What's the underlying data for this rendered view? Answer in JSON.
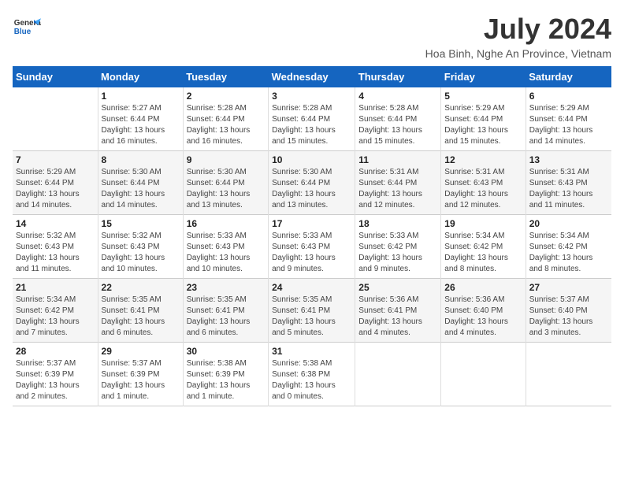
{
  "header": {
    "logo_general": "General",
    "logo_blue": "Blue",
    "month_year": "July 2024",
    "location": "Hoa Binh, Nghe An Province, Vietnam"
  },
  "days_of_week": [
    "Sunday",
    "Monday",
    "Tuesday",
    "Wednesday",
    "Thursday",
    "Friday",
    "Saturday"
  ],
  "weeks": [
    [
      {
        "day": "",
        "info": ""
      },
      {
        "day": "1",
        "info": "Sunrise: 5:27 AM\nSunset: 6:44 PM\nDaylight: 13 hours\nand 16 minutes."
      },
      {
        "day": "2",
        "info": "Sunrise: 5:28 AM\nSunset: 6:44 PM\nDaylight: 13 hours\nand 16 minutes."
      },
      {
        "day": "3",
        "info": "Sunrise: 5:28 AM\nSunset: 6:44 PM\nDaylight: 13 hours\nand 15 minutes."
      },
      {
        "day": "4",
        "info": "Sunrise: 5:28 AM\nSunset: 6:44 PM\nDaylight: 13 hours\nand 15 minutes."
      },
      {
        "day": "5",
        "info": "Sunrise: 5:29 AM\nSunset: 6:44 PM\nDaylight: 13 hours\nand 15 minutes."
      },
      {
        "day": "6",
        "info": "Sunrise: 5:29 AM\nSunset: 6:44 PM\nDaylight: 13 hours\nand 14 minutes."
      }
    ],
    [
      {
        "day": "7",
        "info": "Sunrise: 5:29 AM\nSunset: 6:44 PM\nDaylight: 13 hours\nand 14 minutes."
      },
      {
        "day": "8",
        "info": "Sunrise: 5:30 AM\nSunset: 6:44 PM\nDaylight: 13 hours\nand 14 minutes."
      },
      {
        "day": "9",
        "info": "Sunrise: 5:30 AM\nSunset: 6:44 PM\nDaylight: 13 hours\nand 13 minutes."
      },
      {
        "day": "10",
        "info": "Sunrise: 5:30 AM\nSunset: 6:44 PM\nDaylight: 13 hours\nand 13 minutes."
      },
      {
        "day": "11",
        "info": "Sunrise: 5:31 AM\nSunset: 6:44 PM\nDaylight: 13 hours\nand 12 minutes."
      },
      {
        "day": "12",
        "info": "Sunrise: 5:31 AM\nSunset: 6:43 PM\nDaylight: 13 hours\nand 12 minutes."
      },
      {
        "day": "13",
        "info": "Sunrise: 5:31 AM\nSunset: 6:43 PM\nDaylight: 13 hours\nand 11 minutes."
      }
    ],
    [
      {
        "day": "14",
        "info": "Sunrise: 5:32 AM\nSunset: 6:43 PM\nDaylight: 13 hours\nand 11 minutes."
      },
      {
        "day": "15",
        "info": "Sunrise: 5:32 AM\nSunset: 6:43 PM\nDaylight: 13 hours\nand 10 minutes."
      },
      {
        "day": "16",
        "info": "Sunrise: 5:33 AM\nSunset: 6:43 PM\nDaylight: 13 hours\nand 10 minutes."
      },
      {
        "day": "17",
        "info": "Sunrise: 5:33 AM\nSunset: 6:43 PM\nDaylight: 13 hours\nand 9 minutes."
      },
      {
        "day": "18",
        "info": "Sunrise: 5:33 AM\nSunset: 6:42 PM\nDaylight: 13 hours\nand 9 minutes."
      },
      {
        "day": "19",
        "info": "Sunrise: 5:34 AM\nSunset: 6:42 PM\nDaylight: 13 hours\nand 8 minutes."
      },
      {
        "day": "20",
        "info": "Sunrise: 5:34 AM\nSunset: 6:42 PM\nDaylight: 13 hours\nand 8 minutes."
      }
    ],
    [
      {
        "day": "21",
        "info": "Sunrise: 5:34 AM\nSunset: 6:42 PM\nDaylight: 13 hours\nand 7 minutes."
      },
      {
        "day": "22",
        "info": "Sunrise: 5:35 AM\nSunset: 6:41 PM\nDaylight: 13 hours\nand 6 minutes."
      },
      {
        "day": "23",
        "info": "Sunrise: 5:35 AM\nSunset: 6:41 PM\nDaylight: 13 hours\nand 6 minutes."
      },
      {
        "day": "24",
        "info": "Sunrise: 5:35 AM\nSunset: 6:41 PM\nDaylight: 13 hours\nand 5 minutes."
      },
      {
        "day": "25",
        "info": "Sunrise: 5:36 AM\nSunset: 6:41 PM\nDaylight: 13 hours\nand 4 minutes."
      },
      {
        "day": "26",
        "info": "Sunrise: 5:36 AM\nSunset: 6:40 PM\nDaylight: 13 hours\nand 4 minutes."
      },
      {
        "day": "27",
        "info": "Sunrise: 5:37 AM\nSunset: 6:40 PM\nDaylight: 13 hours\nand 3 minutes."
      }
    ],
    [
      {
        "day": "28",
        "info": "Sunrise: 5:37 AM\nSunset: 6:39 PM\nDaylight: 13 hours\nand 2 minutes."
      },
      {
        "day": "29",
        "info": "Sunrise: 5:37 AM\nSunset: 6:39 PM\nDaylight: 13 hours\nand 1 minute."
      },
      {
        "day": "30",
        "info": "Sunrise: 5:38 AM\nSunset: 6:39 PM\nDaylight: 13 hours\nand 1 minute."
      },
      {
        "day": "31",
        "info": "Sunrise: 5:38 AM\nSunset: 6:38 PM\nDaylight: 13 hours\nand 0 minutes."
      },
      {
        "day": "",
        "info": ""
      },
      {
        "day": "",
        "info": ""
      },
      {
        "day": "",
        "info": ""
      }
    ]
  ]
}
